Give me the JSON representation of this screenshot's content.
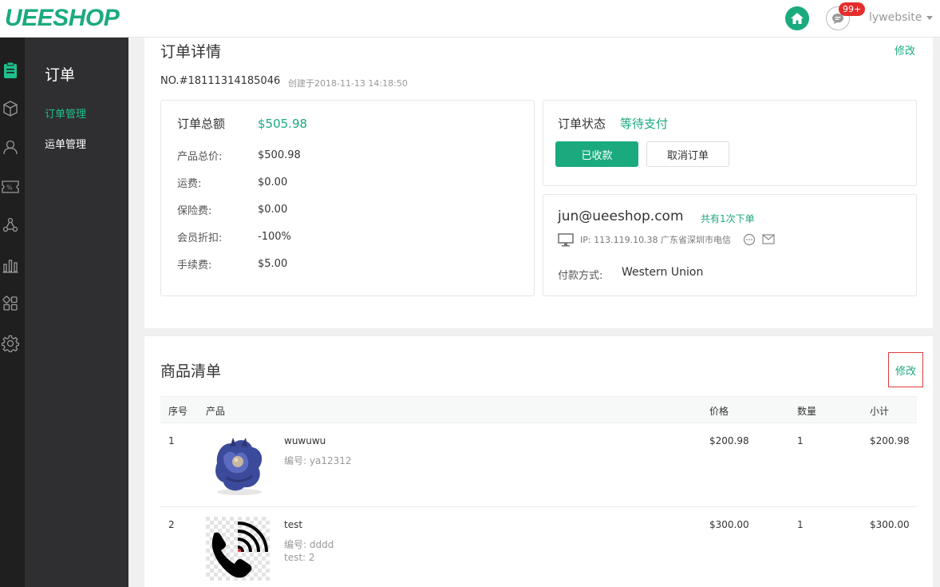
{
  "header": {
    "logo": "UEESHOP",
    "badge": "99+",
    "username": "lywebsite"
  },
  "sidebar": {
    "title": "订单",
    "items": [
      {
        "label": "订单管理",
        "active": true
      },
      {
        "label": "运单管理",
        "active": false
      }
    ]
  },
  "order": {
    "title": "订单详情",
    "edit_label": "修改",
    "number": "NO.#18111314185046",
    "created": "创建于2018-11-13 14:18:50",
    "total_label": "订单总额",
    "total_value": "$505.98",
    "lines": [
      {
        "label": "产品总价:",
        "value": "$500.98"
      },
      {
        "label": "运费:",
        "value": "$0.00"
      },
      {
        "label": "保险费:",
        "value": "$0.00"
      },
      {
        "label": "会员折扣:",
        "value": "-100%"
      },
      {
        "label": "手续费:",
        "value": "$5.00"
      }
    ],
    "status_label": "订单状态",
    "status_value": "等待支付",
    "btn_received": "已收款",
    "btn_cancel": "取消订单",
    "customer_email": "jun@ueeshop.com",
    "customer_orders": "共有1次下单",
    "customer_ip": "IP: 113.119.10.38 广东省深圳市电信",
    "payment_label": "付款方式:",
    "payment_value": "Western Union"
  },
  "products": {
    "title": "商品清单",
    "edit_label": "修改",
    "columns": [
      "序号",
      "产品",
      "价格",
      "数量",
      "小计"
    ],
    "rows": [
      {
        "index": "1",
        "name": "wuwuwu",
        "sku": "编号: ya12312",
        "extra": "",
        "price": "$200.98",
        "qty": "1",
        "subtotal": "$200.98"
      },
      {
        "index": "2",
        "name": "test",
        "sku": "编号: dddd",
        "extra": "test: 2",
        "price": "$300.00",
        "qty": "1",
        "subtotal": "$300.00"
      }
    ]
  },
  "colors": {
    "accent": "#1aaa7e",
    "badge": "#e52d2d",
    "sidebar": "#2f2f31",
    "rail": "#1f1f1f"
  }
}
